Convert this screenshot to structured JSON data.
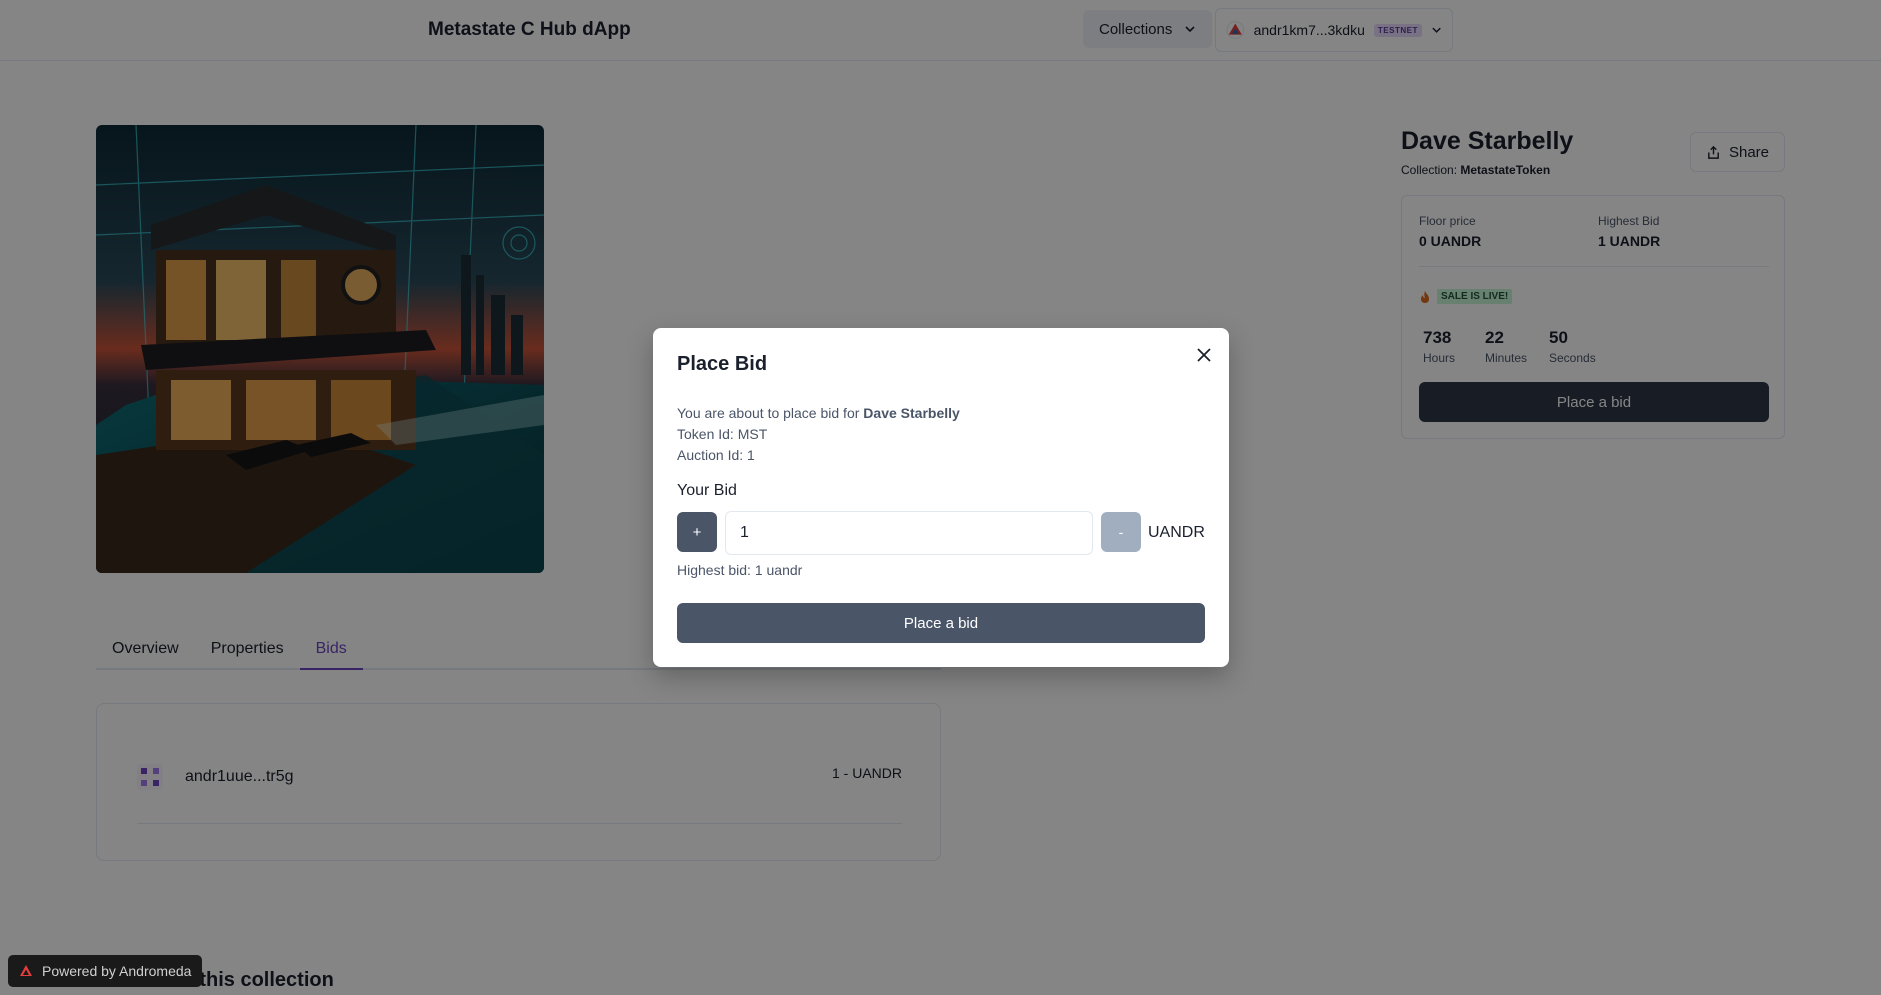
{
  "header": {
    "app_title": "Metastate C Hub dApp",
    "collections_label": "Collections",
    "wallet_address": "andr1km7...3kdku",
    "network_badge": "TESTNET"
  },
  "tabs": [
    "Overview",
    "Properties",
    "Bids"
  ],
  "active_tab": "Bids",
  "bids": [
    {
      "address": "andr1uue...tr5g",
      "amount": "1 - UANDR"
    }
  ],
  "more_section_title": "More from this collection",
  "nft": {
    "name": "Dave Starbelly",
    "collection_prefix": "Collection: ",
    "collection_name": "MetastateToken",
    "share_label": "Share",
    "floor_price_label": "Floor price",
    "floor_price_value": "0 UANDR",
    "highest_bid_label": "Highest Bid",
    "highest_bid_value": "1 UANDR",
    "sale_status": "SALE IS LIVE!",
    "timer": [
      {
        "value": "738",
        "unit": "Hours"
      },
      {
        "value": "22",
        "unit": "Minutes"
      },
      {
        "value": "50",
        "unit": "Seconds"
      }
    ],
    "place_bid_label": "Place a bid"
  },
  "modal": {
    "title": "Place Bid",
    "intro_prefix": "You are about to place bid for ",
    "intro_name": "Dave Starbelly",
    "token_line": "Token Id: MST",
    "auction_line": "Auction Id: 1",
    "your_bid_label": "Your Bid",
    "plus_label": "+",
    "minus_label": "-",
    "bid_value": "1",
    "unit": "UANDR",
    "highest_bid_text": "Highest bid: 1 uandr",
    "submit_label": "Place a bid"
  },
  "footer": {
    "powered_by": "Powered by Andromeda"
  },
  "colors": {
    "accent": "#6b46c1",
    "dark_button": "#2d3748",
    "modal_button": "#4a5568",
    "sale_badge_bg": "#c6f6d5"
  },
  "icons": [
    "chevron-down-icon",
    "andromeda-logo-icon",
    "share-icon",
    "fire-icon",
    "close-icon",
    "bidder-avatar-icon"
  ]
}
